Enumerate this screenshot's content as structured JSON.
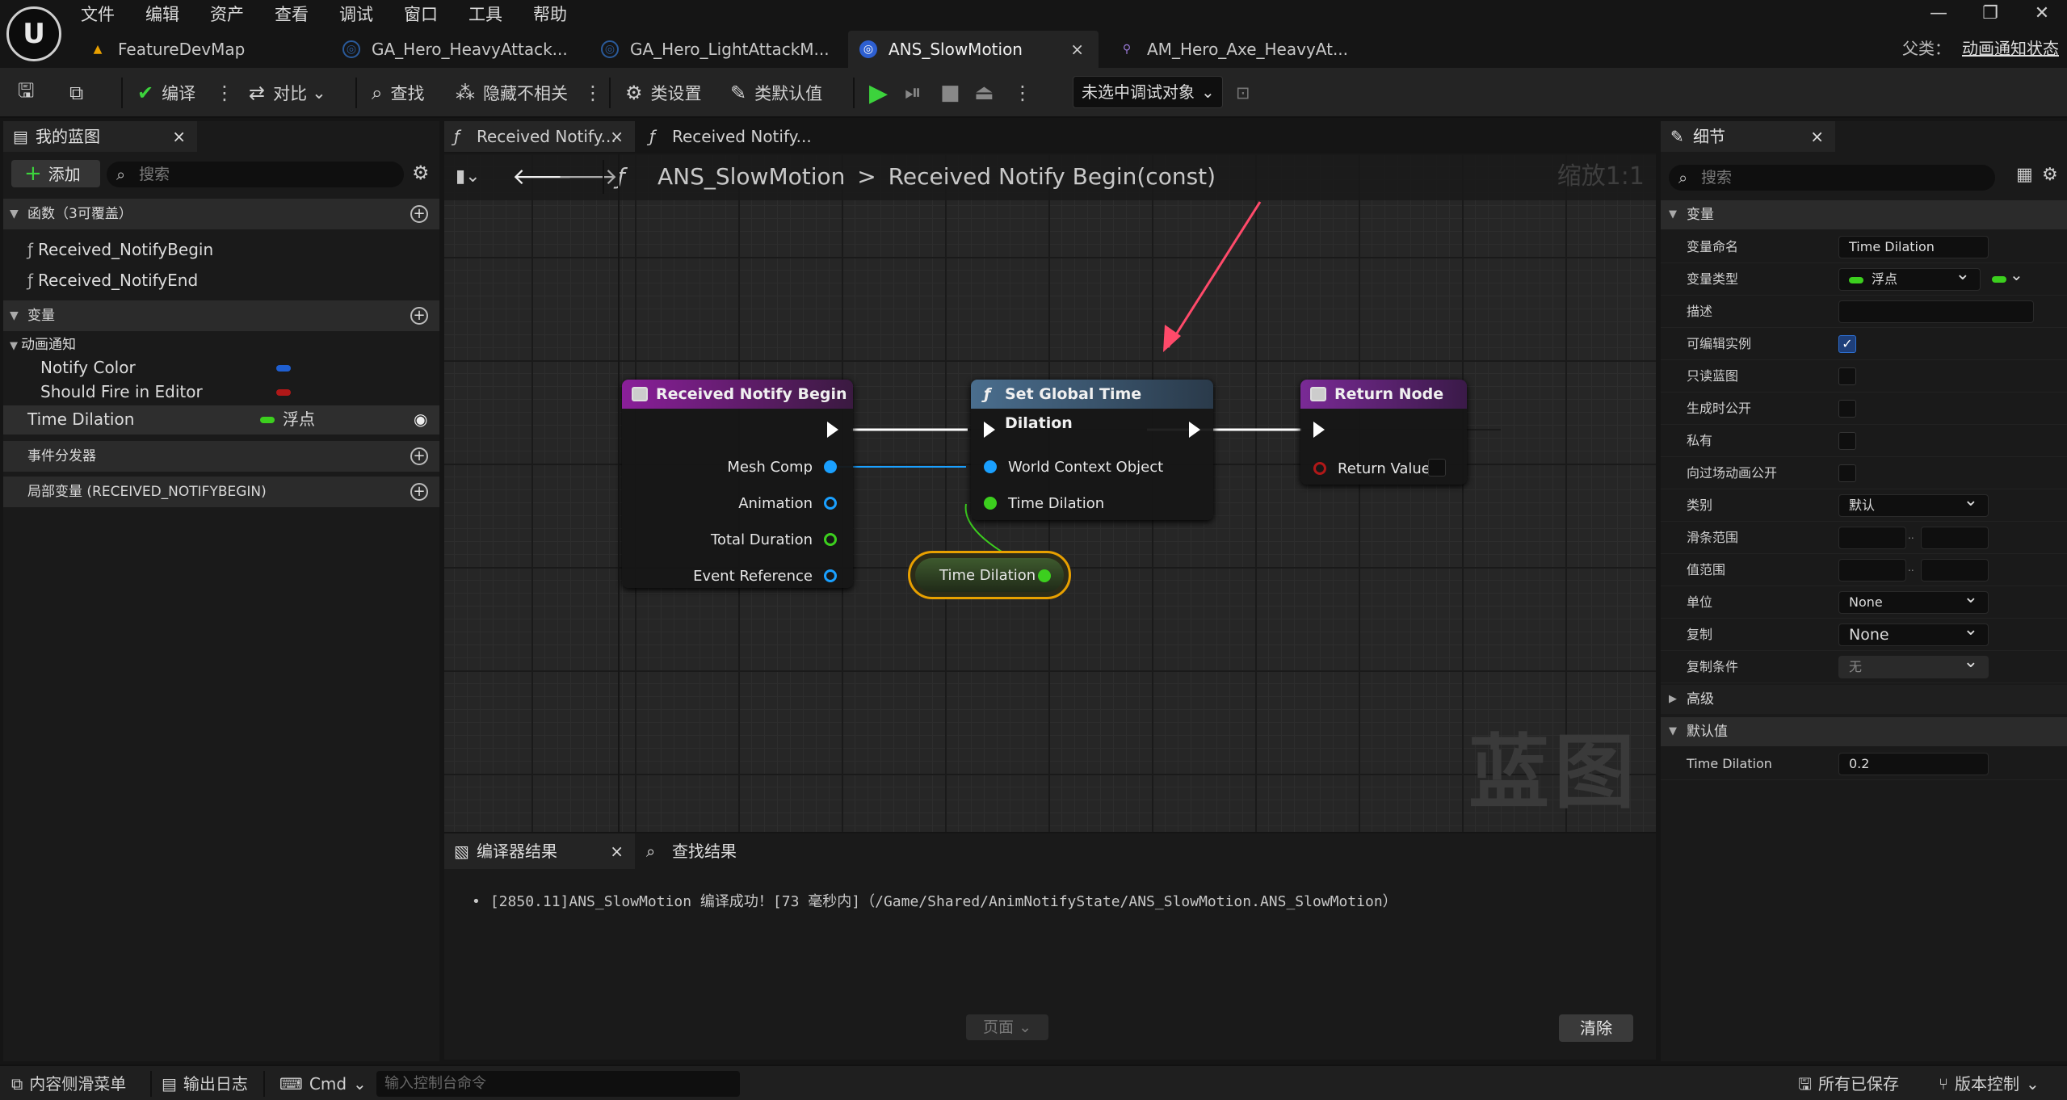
{
  "menu": [
    "文件",
    "编辑",
    "资产",
    "查看",
    "调试",
    "窗口",
    "工具",
    "帮助"
  ],
  "tabs": [
    {
      "label": "FeatureDevMap",
      "icon": "map-icon",
      "active": false
    },
    {
      "label": "GA_Hero_HeavyAttack...",
      "icon": "blueprint-icon",
      "active": false
    },
    {
      "label": "GA_Hero_LightAttackM...",
      "icon": "blueprint-icon",
      "active": false
    },
    {
      "label": "ANS_SlowMotion",
      "icon": "blueprint-icon",
      "active": true
    },
    {
      "label": "AM_Hero_Axe_HeavyAt...",
      "icon": "anim-montage-icon",
      "active": false
    }
  ],
  "tab_close": "×",
  "parent": {
    "label": "父类：",
    "value": "动画通知状态"
  },
  "toolbar": {
    "compile": "编译",
    "diff": "对比",
    "find": "查找",
    "hide": "隐藏不相关",
    "class_settings": "类设置",
    "class_defaults": "类默认值",
    "debug_target": "未选中调试对象"
  },
  "left": {
    "tab": "我的蓝图",
    "add": "添加",
    "search_placeholder": "搜索",
    "functions_header": "函数（3可覆盖）",
    "functions": [
      "Received_NotifyBegin",
      "Received_NotifyEnd"
    ],
    "variables_header": "变量",
    "category": "动画通知",
    "category_vars": [
      {
        "name": "Notify Color",
        "color": "#1f5fd1"
      },
      {
        "name": "Should Fire in Editor",
        "color": "#b01818"
      }
    ],
    "var_name": "Time Dilation",
    "var_type": "浮点",
    "var_color": "#3ccf1e",
    "dispatchers_header": "事件分发器",
    "locals_header": "局部变量 (RECEIVED_NOTIFYBEGIN)"
  },
  "graph_tabs": [
    "Received Notify...",
    "Received Notify..."
  ],
  "breadcrumb": {
    "bp": "ANS_SlowMotion",
    "sep": ">",
    "fn": "Received Notify Begin(const)"
  },
  "zoom": "缩放1:1",
  "watermark": "蓝图",
  "nodes": {
    "begin": {
      "title": "Received Notify Begin",
      "pins": [
        "Mesh Comp",
        "Animation",
        "Total Duration",
        "Event Reference"
      ]
    },
    "setdil": {
      "title": "Set Global Time Dilation",
      "pins": [
        "World Context Object",
        "Time Dilation"
      ]
    },
    "ret": {
      "title": "Return Node",
      "pins": [
        "Return Value"
      ]
    },
    "getvar": {
      "label": "Time Dilation"
    }
  },
  "log": {
    "tab_compiler": "编译器结果",
    "tab_find": "查找结果",
    "line": "[2850.11]ANS_SlowMotion 编译成功！[73 毫秒内]（/Game/Shared/AnimNotifyState/ANS_SlowMotion.ANS_SlowMotion）",
    "page": "页面",
    "clear": "清除"
  },
  "details": {
    "tab": "细节",
    "search_placeholder": "搜索",
    "sec_var": "变量",
    "sec_adv": "高级",
    "sec_default": "默认值",
    "rows": [
      {
        "label": "变量命名",
        "value": "Time Dilation"
      },
      {
        "label": "变量类型",
        "value": "浮点"
      },
      {
        "label": "描述",
        "value": ""
      },
      {
        "label": "可编辑实例",
        "checked": true
      },
      {
        "label": "只读蓝图",
        "checked": false
      },
      {
        "label": "生成时公开",
        "checked": false
      },
      {
        "label": "私有",
        "checked": false
      },
      {
        "label": "向过场动画公开",
        "checked": false
      },
      {
        "label": "类别",
        "value": "默认"
      },
      {
        "label": "滑条范围",
        "value": ""
      },
      {
        "label": "值范围",
        "value": ""
      },
      {
        "label": "单位",
        "value": "None"
      },
      {
        "label": "复制",
        "value": "None"
      },
      {
        "label": "复制条件",
        "value": "无"
      }
    ],
    "range_sep": "..",
    "default_label": "Time Dilation",
    "default_value": "0.2"
  },
  "status": {
    "drawer": "内容侧滑菜单",
    "output": "输出日志",
    "cmd": "Cmd",
    "cmd_placeholder": "输入控制台命令",
    "saved": "所有已保存",
    "vcs": "版本控制"
  },
  "colors": {
    "exec": "#ffffff",
    "object_pin": "#1aa0ff",
    "float_pin": "#3ccf1e",
    "event_header": "#7a1f8a",
    "func_header": "#3d5a7a",
    "return_header": "#6a2a86",
    "var_selected": "#e8a000"
  }
}
